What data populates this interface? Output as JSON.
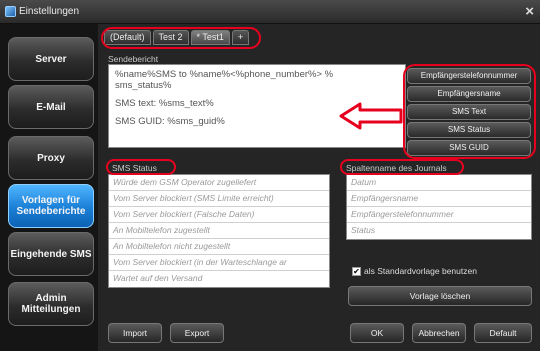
{
  "window": {
    "title": "Einstellungen",
    "close_glyph": "×",
    "icon": "app-icon"
  },
  "sidebar": {
    "items": [
      {
        "label": "Server"
      },
      {
        "label": "E-Mail"
      },
      {
        "label": "Proxy"
      },
      {
        "label": "Vorlagen für Sendeberichte",
        "active": true
      },
      {
        "label": "Eingehende SMS"
      },
      {
        "label": "Admin Mitteilungen"
      }
    ]
  },
  "tabs": [
    {
      "label": "(Default)"
    },
    {
      "label": "Test 2"
    },
    {
      "label": "* Test1",
      "active": true
    },
    {
      "label": "+"
    }
  ],
  "sendebericht": {
    "label": "Sendebericht",
    "lines": [
      "%name%SMS to %name%<%phone_number%> %",
      "sms_status%",
      "SMS text: %sms_text%",
      "SMS GUID: %sms_guid%"
    ]
  },
  "placeholder_buttons": [
    "Empfängerstelefonnummer",
    "Empfängersname",
    "SMS Text",
    "SMS Status",
    "SMS GUID"
  ],
  "sms_status": {
    "label": "SMS Status",
    "rows": [
      "Würde dem GSM Operator zugeliefert",
      "Vom Server blockiert (SMS Limite erreicht)",
      "Vom Server blockiert (Falsche Daten)",
      "An Mobiltelefon zugestellt",
      "An Mobiltelefon nicht zugestellt",
      "Vom Server blockiert (in der Warteschlange ar",
      "Wartet auf den Versand"
    ]
  },
  "journal_columns": {
    "label": "Spaltenname des Journals",
    "rows": [
      "Datum",
      "Empfängersname",
      "Empfängerstelefonnummer",
      "Status"
    ]
  },
  "standard_checkbox": {
    "label": "als Standardvorlage benutzen",
    "checked": true,
    "glyph": "✔"
  },
  "buttons": {
    "delete_template": "Vorlage löschen",
    "import": "Import",
    "export": "Export",
    "ok": "OK",
    "cancel": "Abbrechen",
    "default": "Default"
  },
  "annotation": {
    "color": "#e6001e"
  }
}
